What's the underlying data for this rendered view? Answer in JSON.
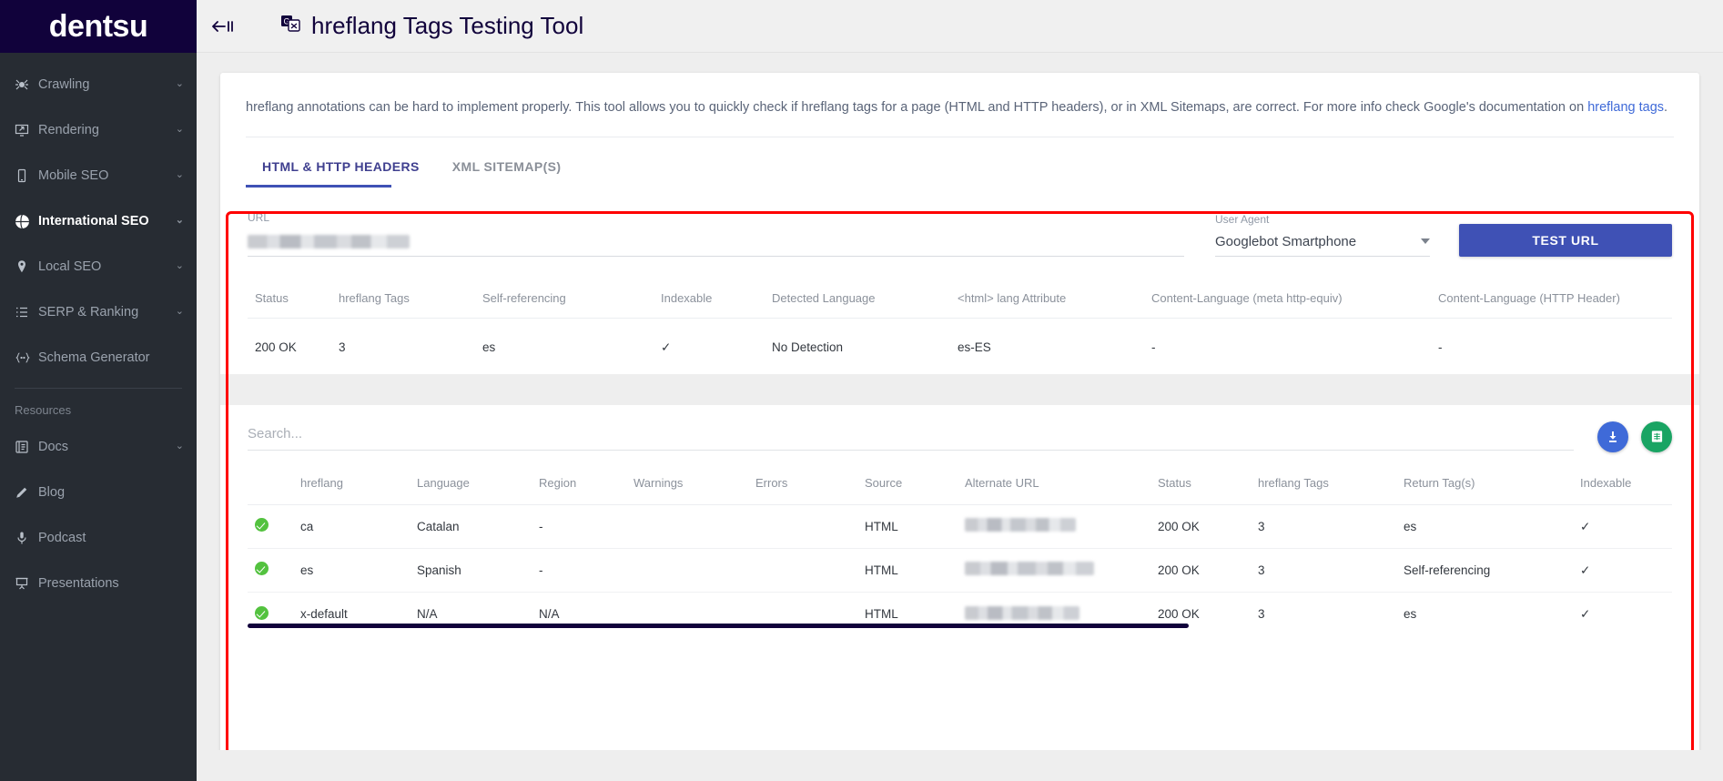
{
  "brand": {
    "name": "dentsu"
  },
  "topbar": {
    "collapse_icon": "collapse-sidebar-icon",
    "title_icon": "translate-icon",
    "title": "hreflang Tags Testing Tool"
  },
  "sidebar": {
    "items": [
      {
        "label": "Crawling",
        "icon": "spider-icon",
        "chevron": "⌄",
        "active": false
      },
      {
        "label": "Rendering",
        "icon": "monitor-icon",
        "chevron": "⌄",
        "active": false
      },
      {
        "label": "Mobile SEO",
        "icon": "phone-icon",
        "chevron": "⌄",
        "active": false
      },
      {
        "label": "International SEO",
        "icon": "globe-icon",
        "chevron": "⌄",
        "active": true
      },
      {
        "label": "Local SEO",
        "icon": "pin-icon",
        "chevron": "⌄",
        "active": false
      },
      {
        "label": "SERP & Ranking",
        "icon": "list-icon",
        "chevron": "⌄",
        "active": false
      },
      {
        "label": "Schema Generator",
        "icon": "braces-icon",
        "chevron": "",
        "active": false
      }
    ],
    "category_label": "Resources",
    "resources": [
      {
        "label": "Docs",
        "icon": "book-icon",
        "chevron": "⌄"
      },
      {
        "label": "Blog",
        "icon": "pencil-icon",
        "chevron": ""
      },
      {
        "label": "Podcast",
        "icon": "microphone-icon",
        "chevron": ""
      },
      {
        "label": "Presentations",
        "icon": "presentation-icon",
        "chevron": ""
      }
    ]
  },
  "description": {
    "text_before_link": "hreflang annotations can be hard to implement properly. This tool allows you to quickly check if hreflang tags for a page (HTML and HTTP headers), or in XML Sitemaps, are correct. For more info check Google's documentation on ",
    "link_text": "hreflang tags",
    "text_after_link": "."
  },
  "tabs": [
    {
      "label": "HTML & HTTP HEADERS",
      "active": true
    },
    {
      "label": "XML SITEMAP(S)",
      "active": false
    }
  ],
  "form": {
    "url_label": "URL",
    "url_value": "",
    "url_redacted": true,
    "user_agent_label": "User Agent",
    "user_agent_value": "Googlebot Smartphone",
    "test_button": "TEST URL"
  },
  "summary_table": {
    "headers": [
      "Status",
      "hreflang Tags",
      "Self-referencing",
      "Indexable",
      "Detected Language",
      "<html> lang Attribute",
      "Content-Language (meta http-equiv)",
      "Content-Language (HTTP Header)"
    ],
    "rows": [
      {
        "status": "200 OK",
        "hreflang_tags": "3",
        "self_referencing": "es",
        "indexable": "✓",
        "detected_language": "No Detection",
        "html_lang_attribute": "es-ES",
        "content_language_meta": "-",
        "content_language_header": "-"
      }
    ]
  },
  "search": {
    "placeholder": "Search...",
    "value": "",
    "download_icon": "download-icon",
    "sheets_icon": "google-sheets-icon"
  },
  "details_table": {
    "headers": [
      "",
      "hreflang",
      "Language",
      "Region",
      "Warnings",
      "Errors",
      "Source",
      "Alternate URL",
      "Status",
      "hreflang Tags",
      "Return Tag(s)",
      "Indexable"
    ],
    "rows": [
      {
        "ok": true,
        "hreflang": "ca",
        "language": "Catalan",
        "region": "-",
        "warnings": "",
        "errors": "",
        "source": "HTML",
        "alternate_url": "",
        "alternate_url_redacted": true,
        "status": "200 OK",
        "hreflang_tags": "3",
        "return_tags": "es",
        "indexable": "✓"
      },
      {
        "ok": true,
        "hreflang": "es",
        "language": "Spanish",
        "region": "-",
        "warnings": "",
        "errors": "",
        "source": "HTML",
        "alternate_url": "",
        "alternate_url_redacted": true,
        "status": "200 OK",
        "hreflang_tags": "3",
        "return_tags": "Self-referencing",
        "indexable": "✓"
      },
      {
        "ok": true,
        "hreflang": "x-default",
        "language": "N/A",
        "region": "N/A",
        "warnings": "",
        "errors": "",
        "source": "HTML",
        "alternate_url": "",
        "alternate_url_redacted": true,
        "status": "200 OK",
        "hreflang_tags": "3",
        "return_tags": "es",
        "indexable": "✓"
      }
    ]
  },
  "colors": {
    "brand_navy": "#11023b",
    "sidebar_bg": "#272c33",
    "accent_blue": "#3f51b5",
    "link_blue": "#3f6ad8",
    "success_green": "#53c23f",
    "sheets_green": "#19a463",
    "annotation_red": "#ff0000"
  }
}
